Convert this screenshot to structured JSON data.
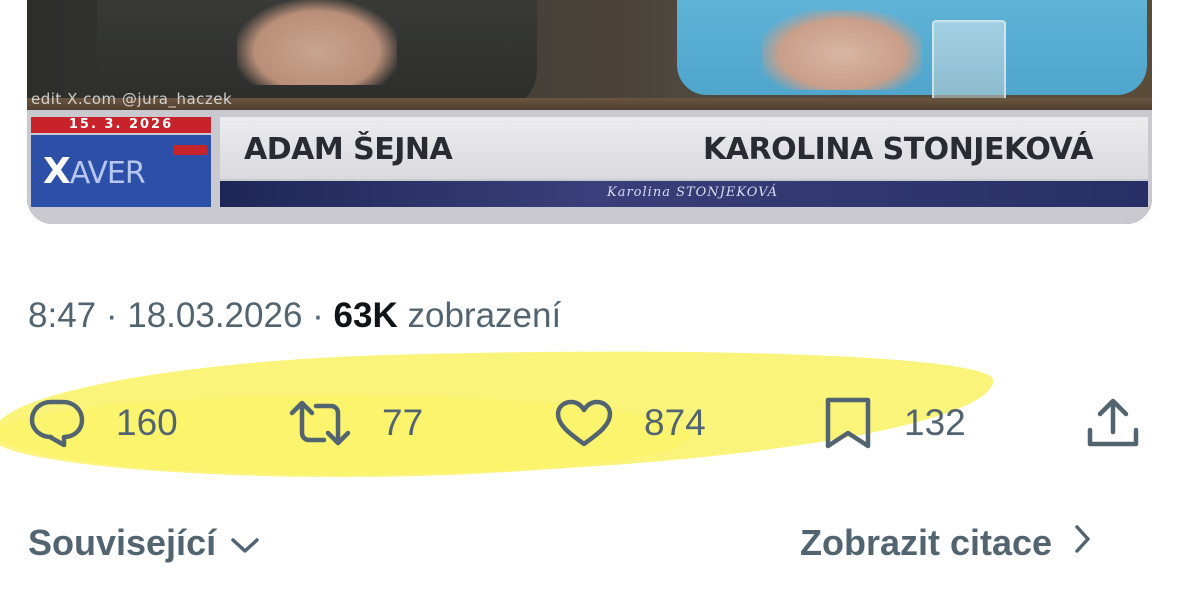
{
  "media": {
    "credit": "edit X.com @jura_haczek",
    "date": "15. 3. 2026",
    "logo": {
      "main": "X",
      "rest": "AVER"
    },
    "guest_left": "ADAM ŠEJNA",
    "guest_right": "KAROLINA STONJEKOVÁ",
    "subtitle": "Karolina STONJEKOVÁ"
  },
  "tweet": {
    "time": "8:47",
    "date": "18.03.2026",
    "views_count": "63K",
    "views_label": "zobrazení"
  },
  "actions": {
    "replies": "160",
    "retweets": "77",
    "likes": "874",
    "bookmarks": "132"
  },
  "footer": {
    "related_label": "Související",
    "quotes_label": "Zobrazit citace"
  },
  "colors": {
    "secondary_text": "#536471",
    "primary_text": "#0f1419",
    "highlight": "#fbf36b",
    "logo_blue": "#2c50a8",
    "accent_red": "#c8232b"
  },
  "icons": [
    "reply-icon",
    "retweet-icon",
    "like-icon",
    "bookmark-icon",
    "share-icon",
    "chevron-down-icon",
    "chevron-right-icon"
  ]
}
